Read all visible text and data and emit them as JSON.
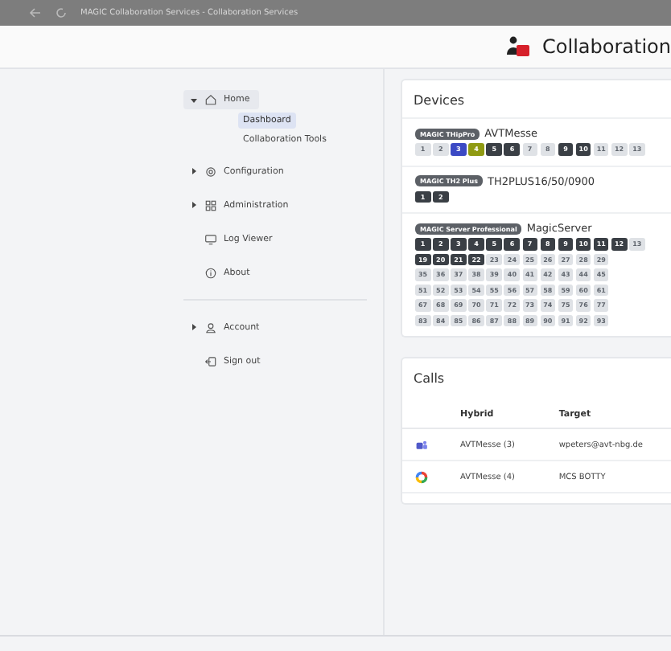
{
  "window": {
    "title": "MAGIC Collaboration Services - Collaboration Services"
  },
  "header": {
    "title": "Collaboration"
  },
  "sidebar": {
    "items": [
      {
        "label": "Home",
        "kind": "home",
        "selected": true,
        "expanded": true,
        "children": [
          {
            "label": "Dashboard",
            "selected": true
          },
          {
            "label": "Collaboration Tools",
            "selected": false
          }
        ]
      },
      {
        "label": "Configuration",
        "kind": "gear",
        "selected": false,
        "expanded": false
      },
      {
        "label": "Administration",
        "kind": "grid",
        "selected": false,
        "expanded": false
      },
      {
        "label": "Log Viewer",
        "kind": "monitor",
        "selected": false
      },
      {
        "label": "About",
        "kind": "info",
        "selected": false
      }
    ],
    "account_items": [
      {
        "label": "Account",
        "kind": "person",
        "selected": false,
        "expanded": false
      },
      {
        "label": "Sign out",
        "kind": "signout",
        "selected": false
      }
    ]
  },
  "devices": {
    "title": "Devices",
    "items": [
      {
        "badge": "MAGIC THipPro",
        "name": "AVTMesse",
        "rows": [
          [
            {
              "label": "1",
              "color": "#dfe2e6"
            },
            {
              "label": "2",
              "color": "#dfe2e6"
            },
            {
              "label": "3",
              "color": "#3b49c4"
            },
            {
              "label": "4",
              "color": "#8f9a12"
            },
            {
              "label": "5",
              "color": "#3a3f45"
            },
            {
              "label": "6",
              "color": "#3a3f45"
            },
            {
              "label": "7",
              "color": "#dfe2e6"
            },
            {
              "label": "8",
              "color": "#dfe2e6"
            },
            {
              "label": "9",
              "color": "#3a3f45"
            },
            {
              "label": "10",
              "color": "#3a3f45"
            },
            {
              "label": "11",
              "color": "#dfe2e6"
            },
            {
              "label": "12",
              "color": "#dfe2e6"
            },
            {
              "label": "13",
              "color": "#dfe2e6"
            }
          ]
        ]
      },
      {
        "badge": "MAGIC TH2 Plus",
        "name": "TH2PLUS16/50/0900",
        "rows": [
          [
            {
              "label": "1",
              "color": "#3a3f45"
            },
            {
              "label": "2",
              "color": "#3a3f45"
            }
          ]
        ]
      },
      {
        "badge": "MAGIC Server Professional",
        "name": "MagicServer",
        "rows": [
          [
            {
              "label": "1",
              "color": "#3a3f45"
            },
            {
              "label": "2",
              "color": "#3a3f45"
            },
            {
              "label": "3",
              "color": "#3a3f45"
            },
            {
              "label": "4",
              "color": "#3a3f45"
            },
            {
              "label": "5",
              "color": "#3a3f45"
            },
            {
              "label": "6",
              "color": "#3a3f45"
            },
            {
              "label": "7",
              "color": "#3a3f45"
            },
            {
              "label": "8",
              "color": "#3a3f45"
            },
            {
              "label": "9",
              "color": "#3a3f45"
            },
            {
              "label": "10",
              "color": "#3a3f45"
            },
            {
              "label": "11",
              "color": "#3a3f45"
            },
            {
              "label": "12",
              "color": "#3a3f45"
            },
            {
              "label": "13",
              "color": "#dfe2e6"
            }
          ],
          [
            {
              "label": "19",
              "color": "#3a3f45"
            },
            {
              "label": "20",
              "color": "#3a3f45"
            },
            {
              "label": "21",
              "color": "#3a3f45"
            },
            {
              "label": "22",
              "color": "#3a3f45"
            },
            {
              "label": "23",
              "color": "#dfe2e6"
            },
            {
              "label": "24",
              "color": "#dfe2e6"
            },
            {
              "label": "25",
              "color": "#dfe2e6"
            },
            {
              "label": "26",
              "color": "#dfe2e6"
            },
            {
              "label": "27",
              "color": "#dfe2e6"
            },
            {
              "label": "28",
              "color": "#dfe2e6"
            },
            {
              "label": "29",
              "color": "#dfe2e6"
            }
          ],
          [
            {
              "label": "35",
              "color": "#dfe2e6"
            },
            {
              "label": "36",
              "color": "#dfe2e6"
            },
            {
              "label": "37",
              "color": "#dfe2e6"
            },
            {
              "label": "38",
              "color": "#dfe2e6"
            },
            {
              "label": "39",
              "color": "#dfe2e6"
            },
            {
              "label": "40",
              "color": "#dfe2e6"
            },
            {
              "label": "41",
              "color": "#dfe2e6"
            },
            {
              "label": "42",
              "color": "#dfe2e6"
            },
            {
              "label": "43",
              "color": "#dfe2e6"
            },
            {
              "label": "44",
              "color": "#dfe2e6"
            },
            {
              "label": "45",
              "color": "#dfe2e6"
            }
          ],
          [
            {
              "label": "51",
              "color": "#dfe2e6"
            },
            {
              "label": "52",
              "color": "#dfe2e6"
            },
            {
              "label": "53",
              "color": "#dfe2e6"
            },
            {
              "label": "54",
              "color": "#dfe2e6"
            },
            {
              "label": "55",
              "color": "#dfe2e6"
            },
            {
              "label": "56",
              "color": "#dfe2e6"
            },
            {
              "label": "57",
              "color": "#dfe2e6"
            },
            {
              "label": "58",
              "color": "#dfe2e6"
            },
            {
              "label": "59",
              "color": "#dfe2e6"
            },
            {
              "label": "60",
              "color": "#dfe2e6"
            },
            {
              "label": "61",
              "color": "#dfe2e6"
            }
          ],
          [
            {
              "label": "67",
              "color": "#dfe2e6"
            },
            {
              "label": "68",
              "color": "#dfe2e6"
            },
            {
              "label": "69",
              "color": "#dfe2e6"
            },
            {
              "label": "70",
              "color": "#dfe2e6"
            },
            {
              "label": "71",
              "color": "#dfe2e6"
            },
            {
              "label": "72",
              "color": "#dfe2e6"
            },
            {
              "label": "73",
              "color": "#dfe2e6"
            },
            {
              "label": "74",
              "color": "#dfe2e6"
            },
            {
              "label": "75",
              "color": "#dfe2e6"
            },
            {
              "label": "76",
              "color": "#dfe2e6"
            },
            {
              "label": "77",
              "color": "#dfe2e6"
            }
          ],
          [
            {
              "label": "83",
              "color": "#dfe2e6"
            },
            {
              "label": "84",
              "color": "#dfe2e6"
            },
            {
              "label": "85",
              "color": "#dfe2e6"
            },
            {
              "label": "86",
              "color": "#dfe2e6"
            },
            {
              "label": "87",
              "color": "#dfe2e6"
            },
            {
              "label": "88",
              "color": "#dfe2e6"
            },
            {
              "label": "89",
              "color": "#dfe2e6"
            },
            {
              "label": "90",
              "color": "#dfe2e6"
            },
            {
              "label": "91",
              "color": "#dfe2e6"
            },
            {
              "label": "92",
              "color": "#dfe2e6"
            },
            {
              "label": "93",
              "color": "#dfe2e6"
            }
          ]
        ]
      }
    ]
  },
  "calls": {
    "title": "Calls",
    "columns": [
      "Hybrid",
      "Target"
    ],
    "rows": [
      {
        "kind": "teams",
        "hybrid": "AVTMesse (3)",
        "target": "wpeters@avt-nbg.de"
      },
      {
        "kind": "ring",
        "hybrid": "AVTMesse (4)",
        "target": "MCS BOTTY"
      }
    ]
  }
}
